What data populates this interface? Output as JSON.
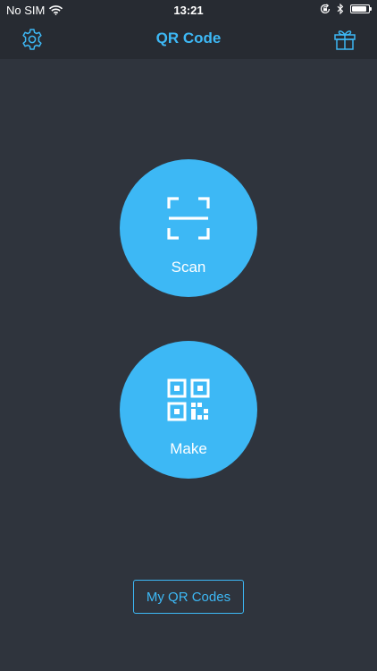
{
  "status_bar": {
    "carrier": "No SIM",
    "time": "13:21",
    "battery_level": 0.9,
    "icons": [
      "wifi-icon",
      "orientation-lock-icon",
      "bluetooth-icon",
      "battery-icon"
    ]
  },
  "navbar": {
    "title": "QR Code",
    "left_icon": "gear-icon",
    "right_icon": "gift-icon"
  },
  "actions": {
    "scan_label": "Scan",
    "make_label": "Make",
    "scan_icon": "scan-frame-icon",
    "make_icon": "qr-code-icon"
  },
  "footer": {
    "my_codes_label": "My QR Codes"
  },
  "colors": {
    "accent": "#3db8f5",
    "background": "#2f343d",
    "bar": "#272b32"
  }
}
